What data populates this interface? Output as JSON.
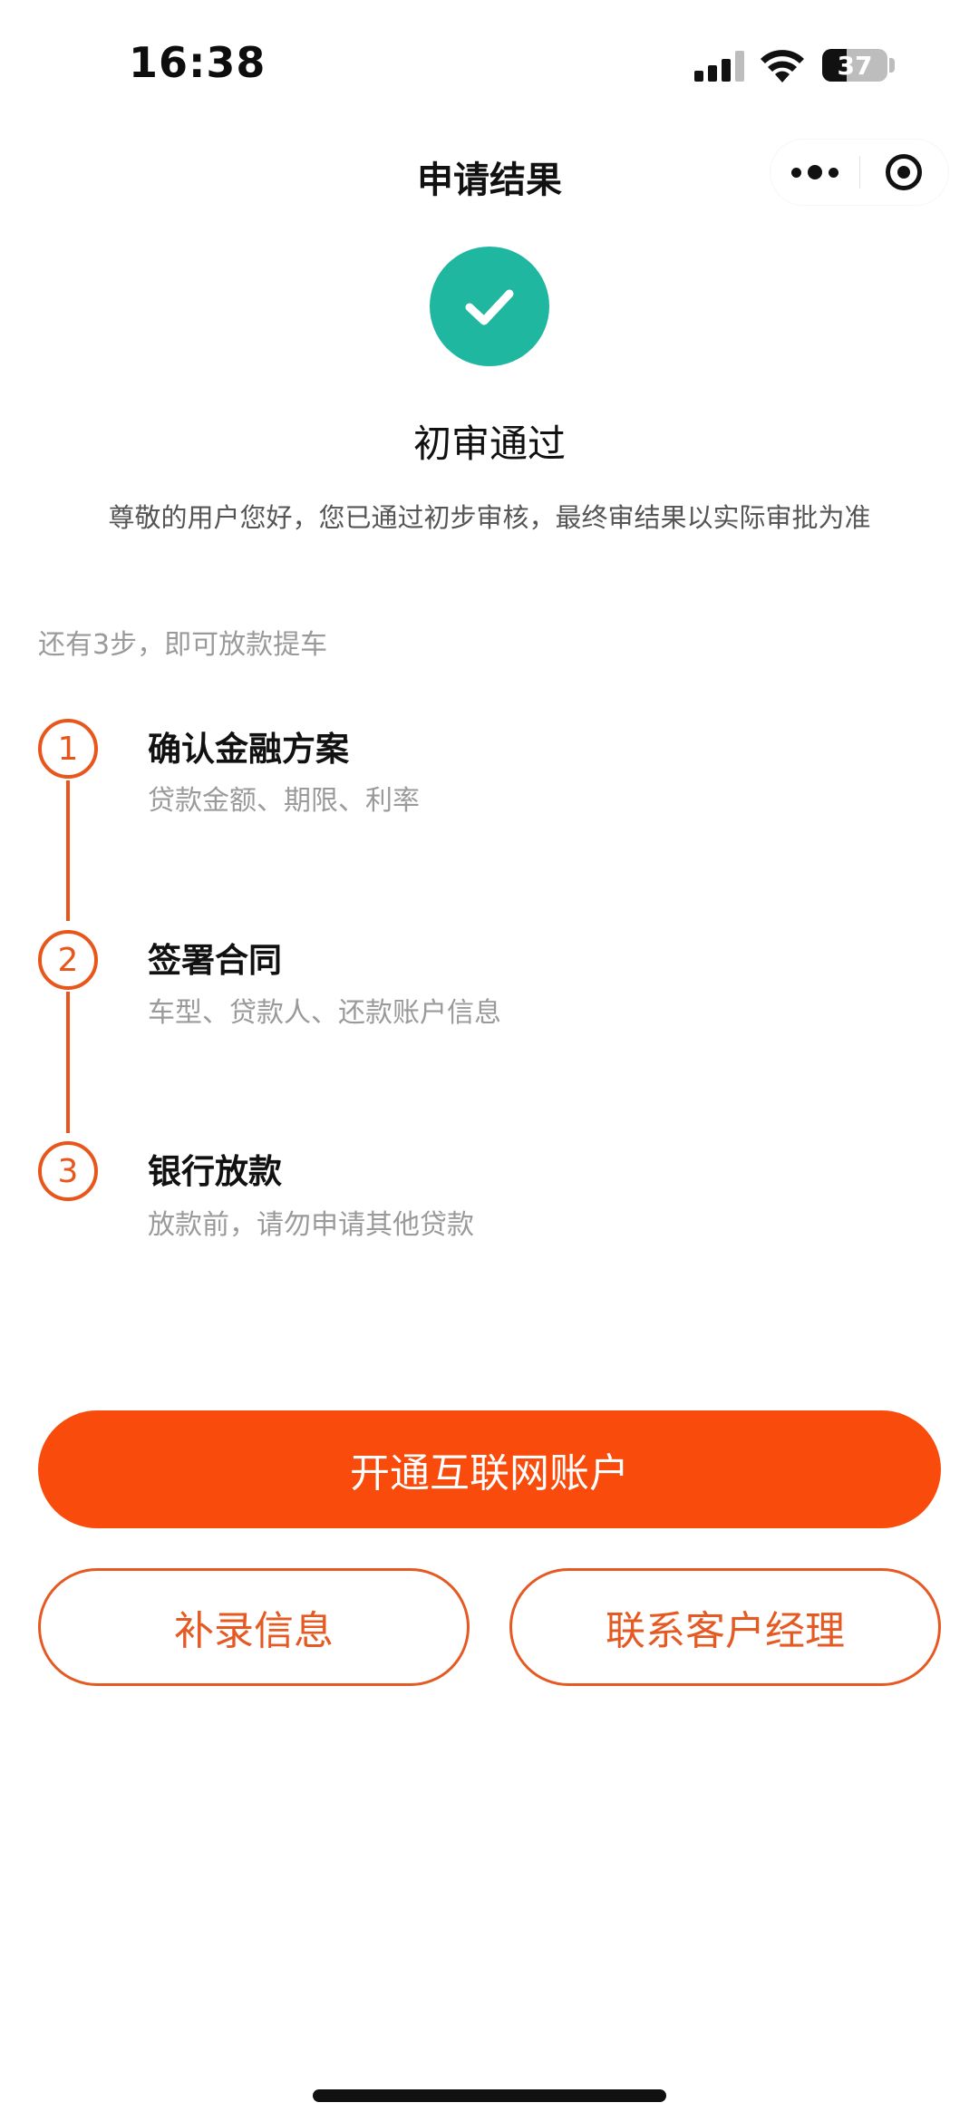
{
  "status_bar": {
    "time": "16:38",
    "battery": "37"
  },
  "nav": {
    "title": "申请结果"
  },
  "result": {
    "title": "初审通过",
    "description": "尊敬的用户您好，您已通过初步审核，最终审结果以实际审批为准",
    "accent_color": "#1fb7a0"
  },
  "steps_hint": "还有3步，即可放款提车",
  "steps": [
    {
      "number": "1",
      "title": "确认金融方案",
      "desc": "贷款金额、期限、利率"
    },
    {
      "number": "2",
      "title": "签署合同",
      "desc": "车型、贷款人、还款账户信息"
    },
    {
      "number": "3",
      "title": "银行放款",
      "desc": "放款前，请勿申请其他贷款"
    }
  ],
  "actions": {
    "primary": "开通互联网账户",
    "secondary_left": "补录信息",
    "secondary_right": "联系客户经理",
    "brand_color": "#f94b0b"
  }
}
